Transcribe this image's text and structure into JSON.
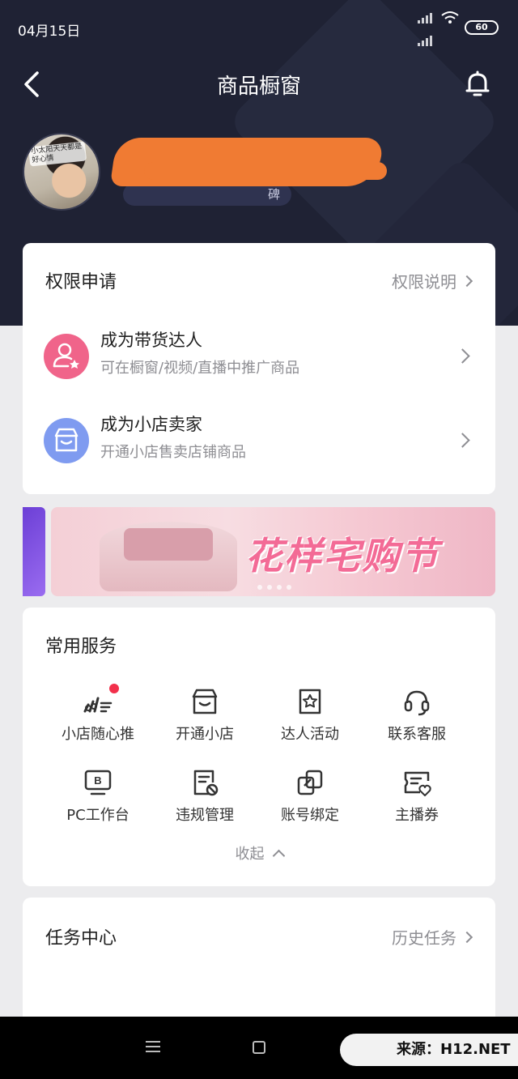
{
  "status_bar": {
    "date": "04月15日",
    "battery": "60"
  },
  "header": {
    "title": "商品橱窗"
  },
  "profile": {
    "avatar_caption": "小太阳天天都是好心情",
    "tag_suffix": "碑"
  },
  "permissions": {
    "title": "权限申请",
    "link": "权限说明",
    "items": [
      {
        "title": "成为带货达人",
        "subtitle": "可在橱窗/视频/直播中推广商品",
        "icon": "user-star-icon",
        "color": "#f0648a"
      },
      {
        "title": "成为小店卖家",
        "subtitle": "开通小店售卖店铺商品",
        "icon": "shop-icon",
        "color": "#7f9bf0"
      }
    ]
  },
  "banner": {
    "text": "花样宅购节"
  },
  "services": {
    "title": "常用服务",
    "items": [
      {
        "label": "小店随心推",
        "icon": "promote-icon"
      },
      {
        "label": "开通小店",
        "icon": "shop-icon"
      },
      {
        "label": "达人活动",
        "icon": "activity-star-icon"
      },
      {
        "label": "联系客服",
        "icon": "headset-icon"
      },
      {
        "label": "PC工作台",
        "icon": "pc-workbench-icon"
      },
      {
        "label": "违规管理",
        "icon": "violation-icon"
      },
      {
        "label": "账号绑定",
        "icon": "account-link-icon"
      },
      {
        "label": "主播券",
        "icon": "coupon-icon"
      }
    ],
    "collapse_label": "收起"
  },
  "tasks": {
    "title": "任务中心",
    "link": "历史任务"
  },
  "watermark": "来源：H12.NET",
  "colors": {
    "header_bg": "#1f2234",
    "accent_red": "#f2304b",
    "banner_pink": "#f36b96"
  }
}
